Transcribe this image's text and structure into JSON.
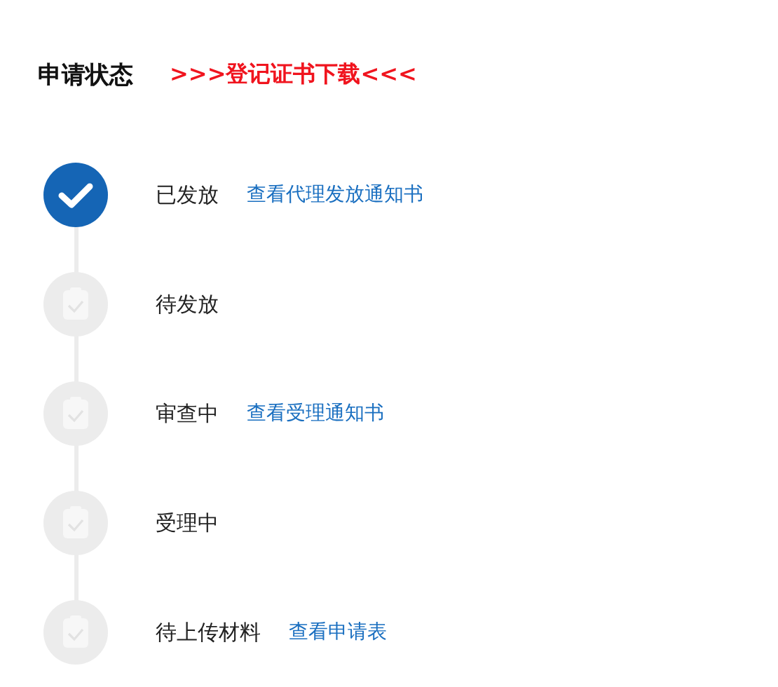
{
  "title": "申请状态",
  "download_link": ">>>登记证书下载<<<",
  "steps": [
    {
      "label": "已发放",
      "done": true,
      "link": "查看代理发放通知书"
    },
    {
      "label": "待发放",
      "done": false
    },
    {
      "label": "审查中",
      "done": false,
      "link": "查看受理通知书"
    },
    {
      "label": "受理中",
      "done": false
    },
    {
      "label": "待上传材料",
      "done": false,
      "link": "查看申请表"
    }
  ]
}
